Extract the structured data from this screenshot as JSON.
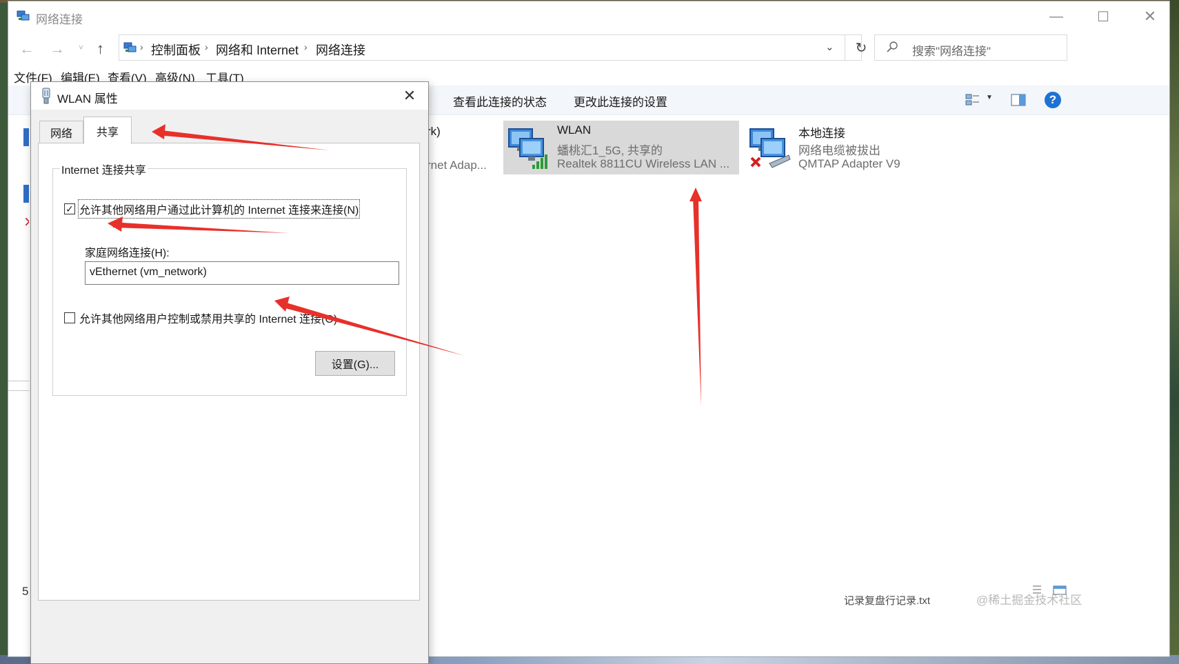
{
  "window": {
    "title": "网络连接",
    "controls": {
      "minimize": "—",
      "maximize": "☐",
      "close": "✕"
    }
  },
  "nav": {
    "back": "←",
    "forward": "→",
    "history": "˅",
    "up": "↑",
    "breadcrumb": [
      "控制面板",
      "网络和 Internet",
      "网络连接"
    ],
    "search_placeholder": "搜索\"网络连接\"",
    "refresh": "↻"
  },
  "menu": [
    "文件(F)",
    "编辑(E)",
    "查看(V)",
    "高级(N)",
    "工具(T)"
  ],
  "commands": {
    "view_status": "查看此连接的状态",
    "change_settings": "更改此连接的设置"
  },
  "connections": [
    {
      "name": "WLAN",
      "line2": "蟠桃汇1_5G, 共享的",
      "line3": "Realtek 8811CU Wireless LAN ...",
      "selected": true
    },
    {
      "name": "本地连接",
      "line2": "网络电缆被拔出",
      "line3": "QMTAP Adapter V9",
      "selected": false
    }
  ],
  "partial_connection": {
    "line1": "rk)",
    "line3": "rnet Adap..."
  },
  "status": {
    "item_count": "5"
  },
  "watermark": "@稀土掘金技术社区",
  "taskbar_text": "记录复盘行记录.txt",
  "dialog": {
    "title": "WLAN 属性",
    "close": "✕",
    "tabs": [
      "网络",
      "共享"
    ],
    "active_tab": "共享",
    "group_title": "Internet 连接共享",
    "allow_connect_label": "允许其他网络用户通过此计算机的 Internet 连接来连接(N)",
    "allow_connect_checked": true,
    "home_label": "家庭网络连接(H):",
    "home_value": "vEthernet (vm_network)",
    "allow_control_label": "允许其他网络用户控制或禁用共享的 Internet 连接(O)",
    "allow_control_checked": false,
    "settings_button": "设置(G)..."
  },
  "colors": {
    "accent": "#1e73d2",
    "annotation_arrow": "#e8302a",
    "selection": "#d9d9d9"
  }
}
